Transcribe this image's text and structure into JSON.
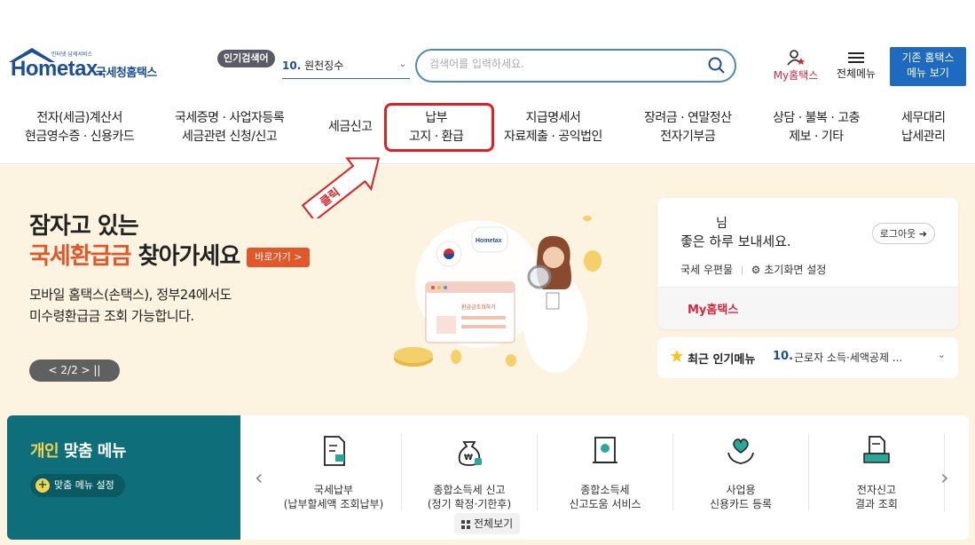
{
  "header": {
    "logo_brand": "Hometax.",
    "logo_tagline": "인터넷 납세서비스",
    "logo_kor": "국세청홈택스",
    "popular_label": "인기검색어",
    "popular_rank": "10.",
    "popular_term": "원천징수",
    "search_placeholder": "검색어를 입력하세요.",
    "myhometax": "My홈택스",
    "all_menu": "전체메뉴",
    "old_hometax_line1": "기존 홈택스",
    "old_hometax_line2": "메뉴 보기"
  },
  "gnb": [
    {
      "line1": "전자(세금)계산서",
      "line2": "현금영수증 · 신용카드"
    },
    {
      "line1": "국세증명 · 사업자등록",
      "line2": "세금관련 신청/신고"
    },
    {
      "line1": "세금신고",
      "line2": ""
    },
    {
      "line1": "납부",
      "line2": "고지 · 환급"
    },
    {
      "line1": "지급명세서",
      "line2": "자료제출 · 공익법인"
    },
    {
      "line1": "장려금 · 연말정산",
      "line2": "전자기부금"
    },
    {
      "line1": "상담 · 불복 · 고충",
      "line2": "제보 · 기타"
    },
    {
      "line1": "세무대리",
      "line2": "납세관리"
    }
  ],
  "annotation": {
    "click_label": "클릭",
    "highlight_color": "#e02020"
  },
  "banner": {
    "headline1": "잠자고 있는",
    "headline2_accent": "국세환급금",
    "headline2_rest": " 찾아가세요",
    "goto_label": "바로가기 >",
    "desc1": "모바일 홈택스(손택스), 정부24에서도",
    "desc2": "미수령환급금 조회 가능합니다.",
    "pager": "< 2/2 >  ||",
    "illus_logo": "Hometax",
    "illus_window_label": "환급금조회하기"
  },
  "login": {
    "name_suffix": "님",
    "greeting": "좋은 하루 보내세요.",
    "logout": "로그아웃",
    "mailbox": "국세 우편물",
    "home_setting": "초기화면 설정",
    "myhometax": "My홈택스"
  },
  "recent": {
    "label": "최근 인기메뉴",
    "rank": "10.",
    "text": "근로자 소득·세액공제 ..."
  },
  "menu": {
    "title_accent": "개인",
    "title_rest": " 맞춤 메뉴",
    "custom_setting": "맞춤 메뉴 설정",
    "tiles": [
      {
        "line1": "국세납부",
        "line2": "(납부할세액 조회납부)",
        "icon": "tax-payment-icon"
      },
      {
        "line1": "종합소득세 신고",
        "line2": "(정기 확정·기한후)",
        "icon": "money-bag-icon"
      },
      {
        "line1": "종합소득세",
        "line2": "신고도움 서비스",
        "icon": "help-document-icon"
      },
      {
        "line1": "사업용",
        "line2": "신용카드 등록",
        "icon": "heart-hand-icon"
      },
      {
        "line1": "전자신고",
        "line2": "결과 조회",
        "icon": "printer-result-icon"
      }
    ],
    "view_all": "전체보기"
  }
}
